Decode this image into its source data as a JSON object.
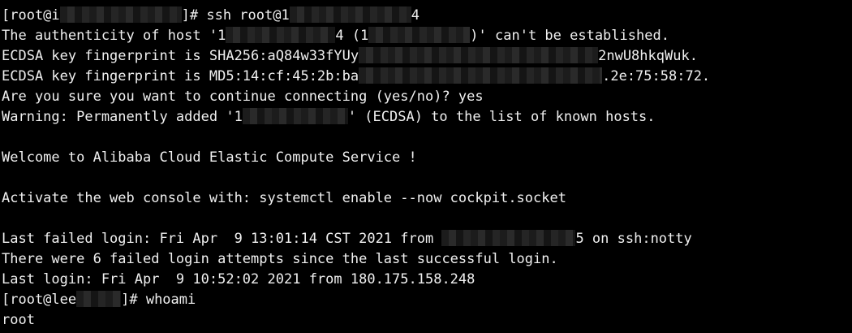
{
  "terminal": {
    "background": "#000000",
    "foreground": "#f0f0f0",
    "redaction_color": "#222222",
    "lines": [
      {
        "parts": [
          {
            "text": "[root@i"
          },
          {
            "redacted": true,
            "width": 150
          },
          {
            "text": "]# ssh root@1"
          },
          {
            "redacted": true,
            "width": 150
          },
          {
            "text": "4"
          }
        ]
      },
      {
        "parts": [
          {
            "text": "The authenticity of host '1"
          },
          {
            "redacted": true,
            "width": 135
          },
          {
            "text": "4 (1"
          },
          {
            "redacted": true,
            "width": 125
          },
          {
            "text": ")' can't be established."
          }
        ]
      },
      {
        "parts": [
          {
            "text": "ECDSA key fingerprint is SHA256:aQ84w33fYUy"
          },
          {
            "redacted": true,
            "width": 295
          },
          {
            "text": "2nwU8hkqWuk."
          }
        ]
      },
      {
        "parts": [
          {
            "text": "ECDSA key fingerprint is MD5:14:cf:45:2b:ba"
          },
          {
            "redacted": true,
            "width": 300
          },
          {
            "text": ".2e:75:58:72."
          }
        ]
      },
      {
        "parts": [
          {
            "text": "Are you sure you want to continue connecting (yes/no)? yes"
          }
        ]
      },
      {
        "parts": [
          {
            "text": "Warning: Permanently added '1"
          },
          {
            "redacted": true,
            "width": 130
          },
          {
            "text": "' (ECDSA) to the list of known hosts."
          }
        ]
      },
      {
        "parts": [
          {
            "text": ""
          }
        ]
      },
      {
        "parts": [
          {
            "text": "Welcome to Alibaba Cloud Elastic Compute Service !"
          }
        ]
      },
      {
        "parts": [
          {
            "text": ""
          }
        ]
      },
      {
        "parts": [
          {
            "text": "Activate the web console with: systemctl enable --now cockpit.socket"
          }
        ]
      },
      {
        "parts": [
          {
            "text": ""
          }
        ]
      },
      {
        "parts": [
          {
            "text": "Last failed login: Fri Apr  9 13:01:14 CST 2021 from "
          },
          {
            "redacted": true,
            "width": 165
          },
          {
            "text": "5 on ssh:notty"
          }
        ]
      },
      {
        "parts": [
          {
            "text": "There were 6 failed login attempts since the last successful login."
          }
        ]
      },
      {
        "parts": [
          {
            "text": "Last login: Fri Apr  9 10:52:02 2021 from 180.175.158.248"
          }
        ]
      },
      {
        "parts": [
          {
            "text": "[root@lee"
          },
          {
            "redacted": true,
            "width": 55
          },
          {
            "text": "]# whoami"
          }
        ]
      },
      {
        "parts": [
          {
            "text": "root"
          }
        ]
      }
    ]
  }
}
